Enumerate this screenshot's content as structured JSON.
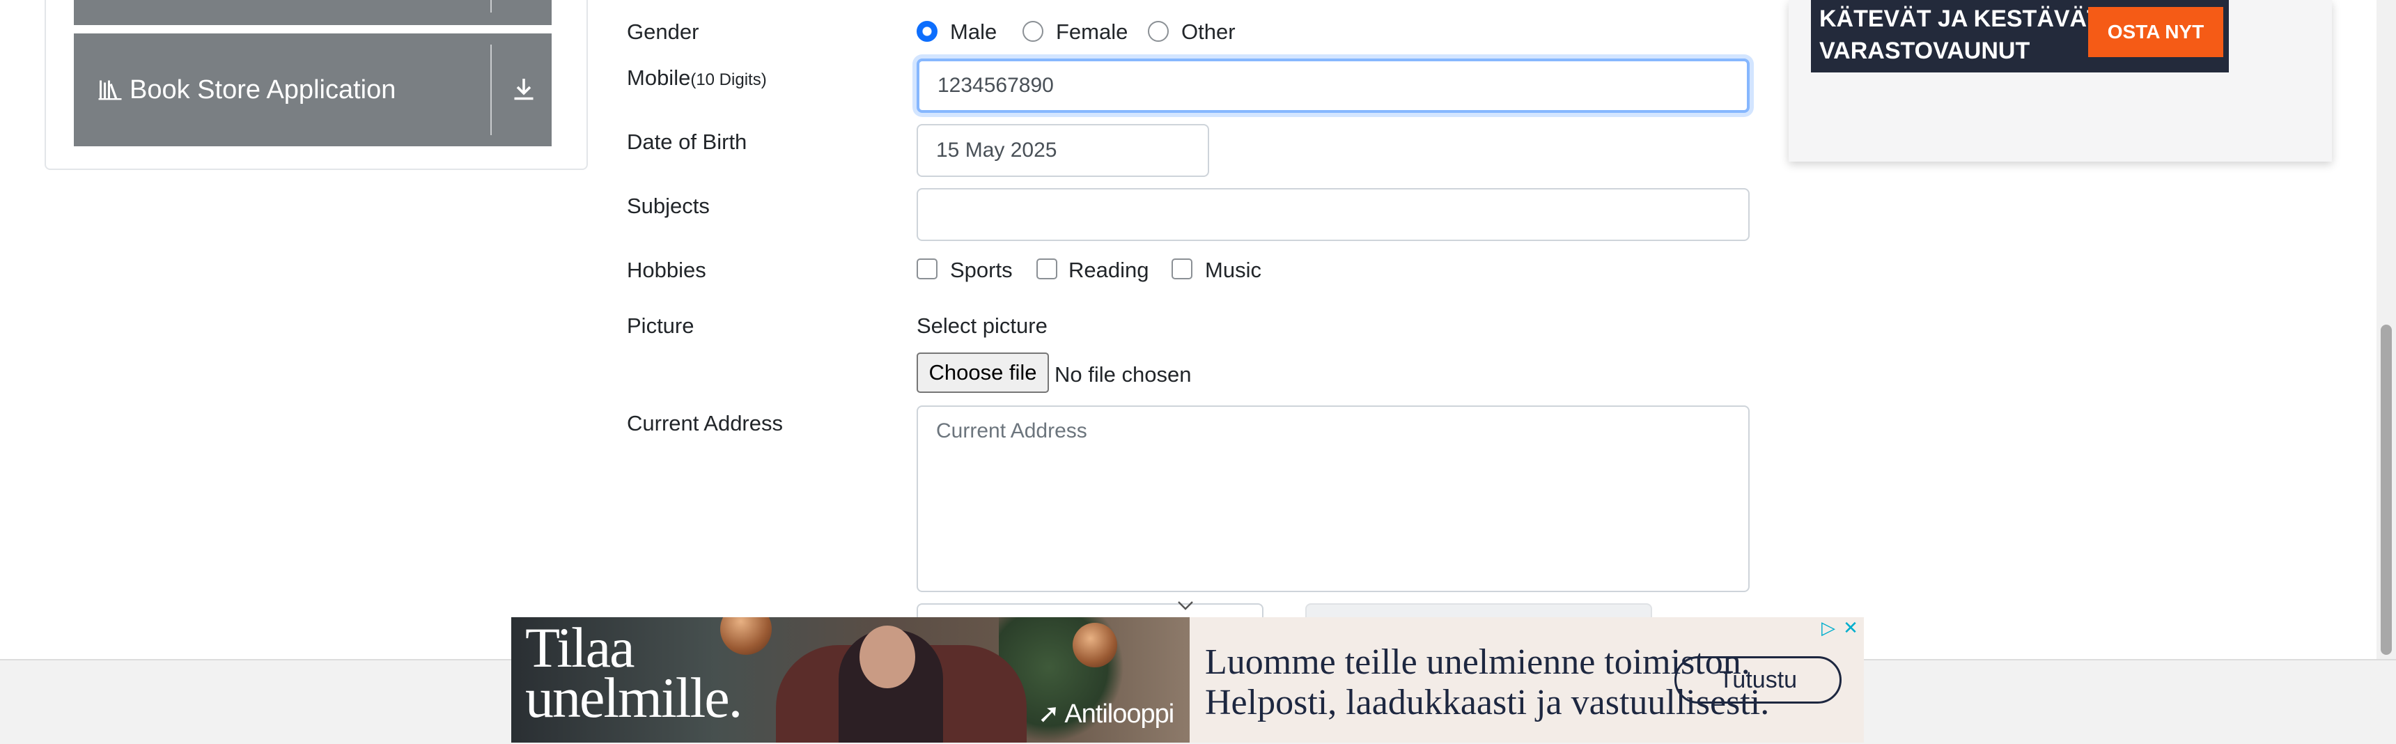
{
  "sidebar": {
    "items": [
      {
        "label": "Book Store Application",
        "icon": "books-icon",
        "action_icon": "download-icon"
      }
    ]
  },
  "form": {
    "gender": {
      "label": "Gender",
      "options": [
        "Male",
        "Female",
        "Other"
      ],
      "selected": "Male"
    },
    "mobile": {
      "label": "Mobile",
      "hint": "(10 Digits)",
      "value": "1234567890"
    },
    "dob": {
      "label": "Date of Birth",
      "value": "15 May 2025"
    },
    "subjects": {
      "label": "Subjects",
      "value": ""
    },
    "hobbies": {
      "label": "Hobbies",
      "options": [
        "Sports",
        "Reading",
        "Music"
      ]
    },
    "picture": {
      "label": "Picture",
      "select_text": "Select picture",
      "button": "Choose file",
      "status": "No file chosen"
    },
    "address": {
      "label": "Current Address",
      "placeholder": "Current Address"
    }
  },
  "ads": {
    "right": {
      "line1": "KÄTEVÄT JA KESTÄVÄT",
      "line2": "VARASTOVAUNUT",
      "cta": "OSTA NYT"
    },
    "bottom": {
      "headline_line1": "Tilaa",
      "headline_line2": "unelmille.",
      "brand": "Antilooppi",
      "copy_line1": "Luomme teille unelmienne toimiston.",
      "copy_line2": "Helposti, laadukkaasti ja vastuullisesti.",
      "cta": "Tutustu"
    }
  },
  "colors": {
    "accent": "#0d6efd",
    "focus_ring": "#86b7fe",
    "sidebar_button": "#7a7f83",
    "ad_cta_orange": "#f55b16",
    "ad_dark": "#232a3b"
  }
}
